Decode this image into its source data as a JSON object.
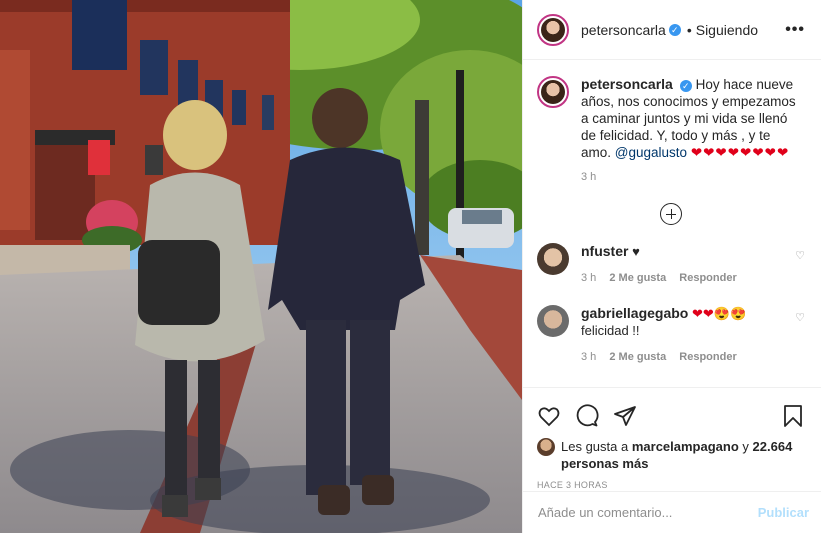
{
  "post": {
    "username": "petersoncarla",
    "follow_status": "Siguiendo",
    "separator": "•",
    "more_label": "•••",
    "caption": "Hoy hace nueve años, nos conocimos y empezamos a caminar juntos y mi vida se llenó de felicidad. Y, todo y más , y te amo.",
    "caption_mention": "@gugalusto",
    "caption_hearts": "❤❤❤❤❤❤❤❤",
    "caption_time": "3 h"
  },
  "comments": [
    {
      "username": "nfuster",
      "text": "♥",
      "time": "3 h",
      "likes": "2 Me gusta",
      "reply": "Responder"
    },
    {
      "username": "gabriellagegabo",
      "text": "❤❤😍😍",
      "text2": "felicidad !!",
      "time": "3 h",
      "likes": "2 Me gusta",
      "reply": "Responder"
    }
  ],
  "likes": {
    "prefix": "Les gusta a",
    "user": "marcelampagano",
    "conj": "y",
    "others": "22.664 personas más"
  },
  "posted_ago": "HACE 3 HORAS",
  "comment_box": {
    "placeholder": "Añade un comentario...",
    "publish": "Publicar"
  },
  "icons": {
    "like": "heart-outline-icon",
    "comment": "comment-bubble-icon",
    "share": "paper-plane-icon",
    "save": "bookmark-icon",
    "load_more": "plus-circle-icon",
    "verified": "verified-badge-icon"
  },
  "colors": {
    "verified": "#3897f0",
    "link": "#00376b",
    "muted": "#8e8e8e",
    "publish_disabled": "#b2dffc",
    "heart": "#e0001a"
  }
}
